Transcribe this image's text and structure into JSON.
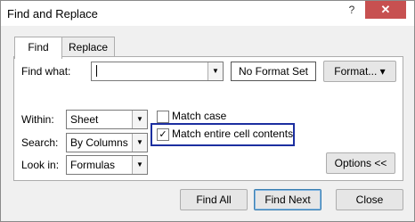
{
  "window": {
    "title": "Find and Replace",
    "help_glyph": "?",
    "close_glyph": "✕"
  },
  "tabs": [
    {
      "label": "Find",
      "active": true
    },
    {
      "label": "Replace",
      "active": false
    }
  ],
  "find": {
    "label": "Find what:",
    "value": "",
    "format_status": "No Format Set",
    "format_button": "Format...",
    "format_arrow": "▾"
  },
  "options": {
    "within": {
      "label": "Within:",
      "value": "Sheet"
    },
    "search": {
      "label": "Search:",
      "value": "By Columns"
    },
    "look_in": {
      "label": "Look in:",
      "value": "Formulas"
    },
    "match_case": {
      "label": "Match case",
      "checked": false
    },
    "match_entire": {
      "label": "Match entire cell contents",
      "checked": true
    },
    "options_button": "Options <<"
  },
  "buttons": {
    "find_all": "Find All",
    "find_next": "Find Next",
    "close": "Close"
  },
  "icons": {
    "dropdown": "▼",
    "check": "✓"
  }
}
